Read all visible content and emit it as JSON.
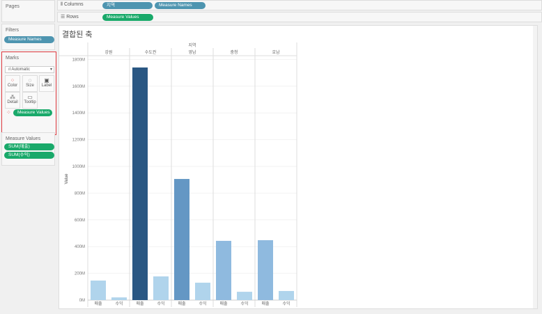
{
  "pages": {
    "title": "Pages"
  },
  "filters": {
    "title": "Filters",
    "pill": "Measure Names"
  },
  "marks": {
    "title": "Marks",
    "type": "Automatic",
    "buttons": [
      "Color",
      "Size",
      "Label",
      "Detail",
      "Tooltip"
    ],
    "pill": "Measure Values"
  },
  "measure_values": {
    "title": "Measure Values",
    "pills": [
      "SUM(매출)",
      "SUM(수익)"
    ]
  },
  "columns": {
    "label": "Columns",
    "pills": [
      "지역",
      "Measure Names"
    ]
  },
  "rows": {
    "label": "Rows",
    "pills": [
      "Measure Values"
    ]
  },
  "sheet_title": "결합된 축",
  "chart_data": {
    "type": "bar",
    "header": "지역",
    "categories": [
      "강원",
      "수도권",
      "영남",
      "충청",
      "호남"
    ],
    "measures": [
      "매출",
      "수익"
    ],
    "series": [
      {
        "name": "매출",
        "values": [
          146,
          1740,
          906,
          443,
          448
        ]
      },
      {
        "name": "수익",
        "values": [
          20,
          177,
          130,
          62,
          68
        ]
      }
    ],
    "ylabel": "Value",
    "ylim": [
      0,
      1800
    ],
    "yticks": [
      "0M",
      "200M",
      "400M",
      "600M",
      "800M",
      "1000M",
      "1200M",
      "1400M",
      "1600M",
      "1800M"
    ],
    "colors": {
      "dark": "#2a5783",
      "mid": "#6497c4",
      "light": "#8fbadf",
      "profit": "#b0d4ec"
    }
  }
}
